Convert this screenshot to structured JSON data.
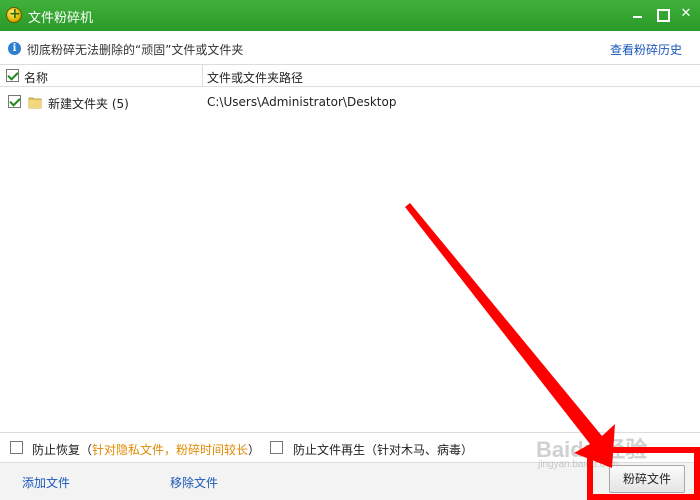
{
  "window": {
    "title": "文件粉碎机",
    "icons": [
      "app-icon",
      "minimize-icon",
      "maximize-icon",
      "close-icon"
    ]
  },
  "infobar": {
    "text": "彻底粉碎无法删除的“顽固”文件或文件夹",
    "history_link": "查看粉碎历史",
    "icon": "info-icon"
  },
  "table": {
    "columns": [
      "名称",
      "文件或文件夹路径"
    ],
    "header_checked": true,
    "rows": [
      {
        "checked": true,
        "icon": "folder-icon",
        "name": "新建文件夹 (5)",
        "path": "C:\\Users\\Administrator\\Desktop"
      }
    ]
  },
  "options": {
    "prevent_recovery": {
      "label": "防止恢复（",
      "note": "针对隐私文件，粉碎时间较长",
      "end": "）",
      "checked": false
    },
    "prevent_regeneration": {
      "label": "防止文件再生（针对木马、病毒）",
      "checked": false
    }
  },
  "actions": {
    "add": "添加文件",
    "remove": "移除文件",
    "shred": "粉碎文件"
  },
  "overlay": {
    "watermark": "Baidu 经验",
    "watermark_sub": "jingyan.baidu.com",
    "annotation_color": "#ff0000"
  },
  "colors": {
    "titlebar": "#2fa52c",
    "link": "#1a57b8",
    "note": "#e08a00"
  }
}
